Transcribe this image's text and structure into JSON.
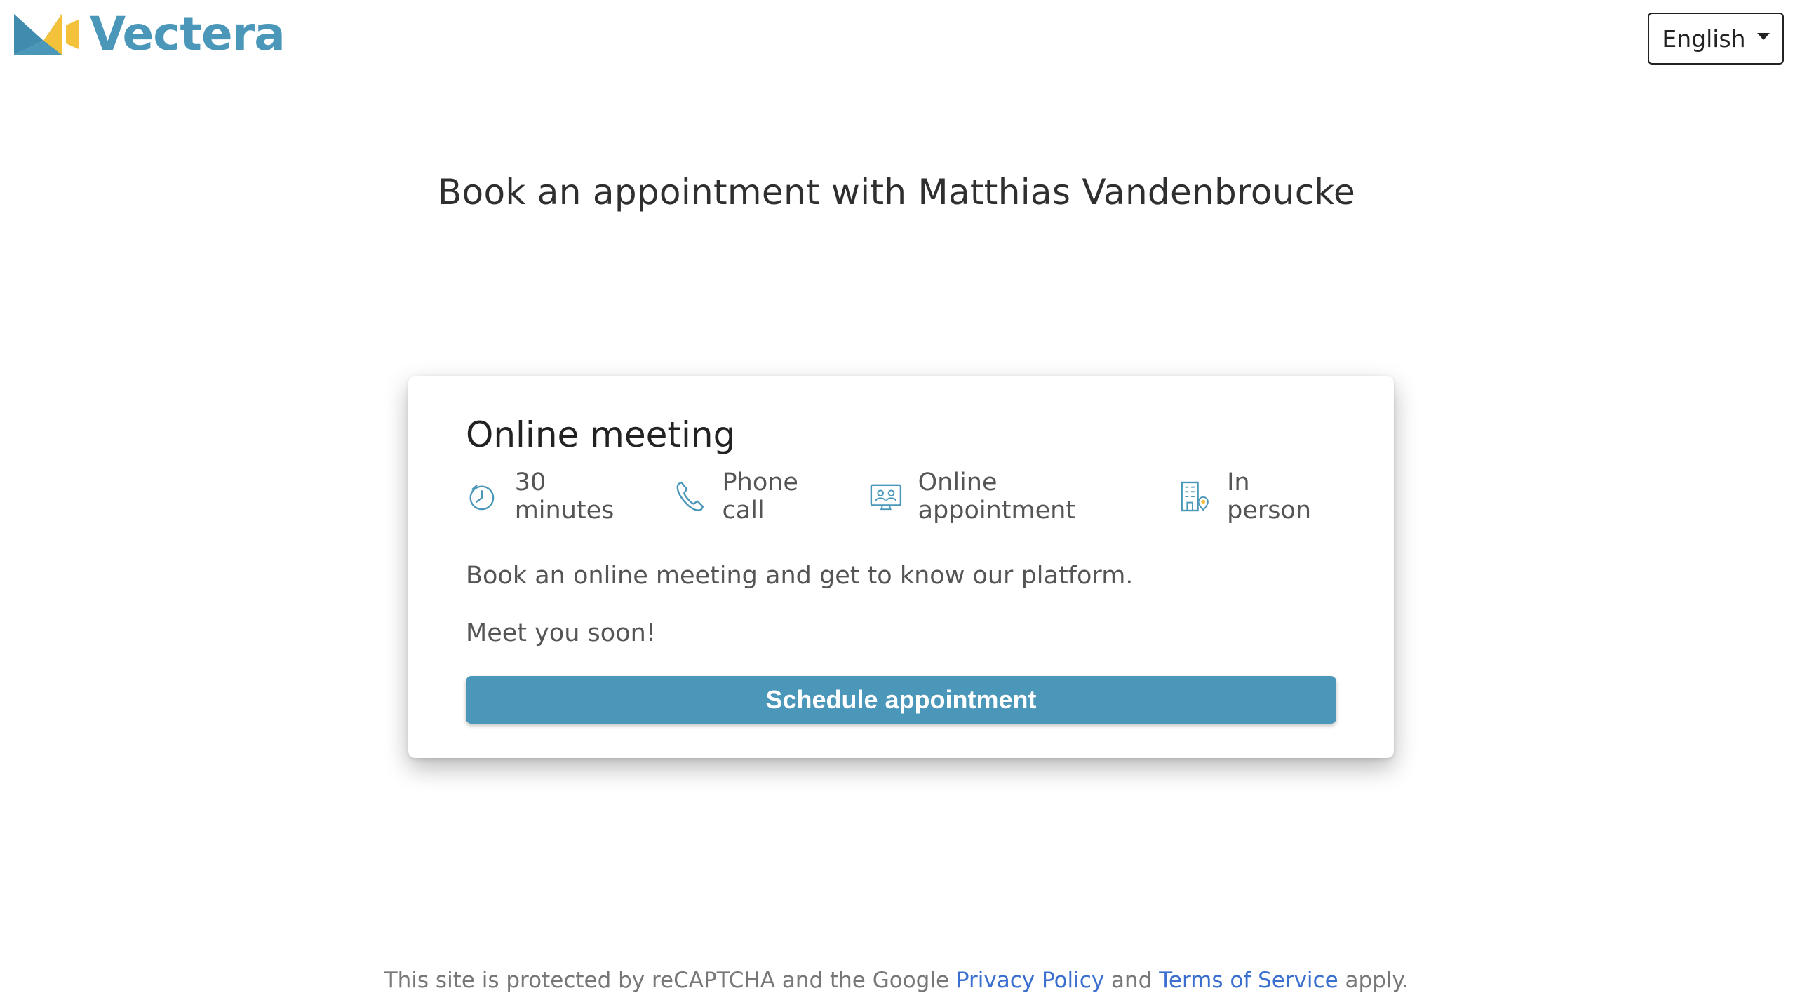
{
  "header": {
    "brand": "Vectera",
    "language": "English"
  },
  "page_title": "Book an appointment with Matthias Vandenbroucke",
  "card": {
    "title": "Online meeting",
    "meta": [
      {
        "icon": "clock-icon",
        "label": "30 minutes"
      },
      {
        "icon": "phone-icon",
        "label": "Phone call"
      },
      {
        "icon": "video-meeting-icon",
        "label": "Online appointment"
      },
      {
        "icon": "location-building-icon",
        "label": "In person"
      }
    ],
    "description": "Book an online meeting and get to know our platform.",
    "closing": "Meet you soon!",
    "button_label": "Schedule appointment"
  },
  "footer": {
    "prefix": "This site is protected by reCAPTCHA and the Google",
    "privacy_link": "Privacy Policy",
    "and": "and",
    "terms_link": "Terms of Service",
    "suffix": "apply."
  },
  "colors": {
    "brand": "#4a97b9",
    "accent_yellow": "#f3c13a",
    "link": "#3a6fcf"
  }
}
